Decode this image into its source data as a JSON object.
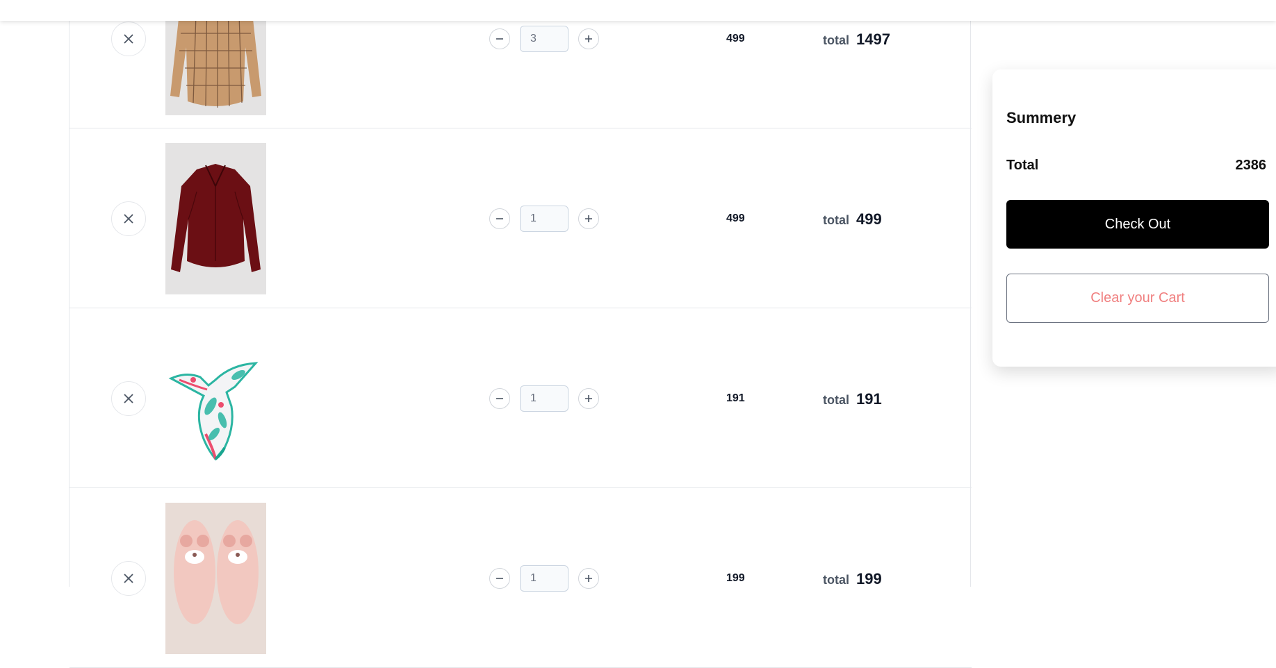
{
  "cart": {
    "items": [
      {
        "image": "plaid-shirt-image",
        "quantity": "3",
        "price": "499",
        "total_label": "total",
        "total": "1497"
      },
      {
        "image": "burgundy-blouse-image",
        "quantity": "1",
        "price": "499",
        "total_label": "total",
        "total": "499"
      },
      {
        "image": "printed-scarf-image",
        "quantity": "1",
        "price": "191",
        "total_label": "total",
        "total": "191"
      },
      {
        "image": "bear-slippers-image",
        "quantity": "1",
        "price": "199",
        "total_label": "total",
        "total": "199"
      }
    ]
  },
  "summary": {
    "title": "Summery",
    "total_label": "Total",
    "total_value": "2386",
    "checkout_label": "Check Out",
    "clear_label": "Clear your Cart"
  },
  "colors": {
    "checkout_bg": "#000000",
    "clear_text": "#f08080",
    "border": "#e5e7eb"
  },
  "icons": {
    "remove": "close-icon",
    "decrement": "minus-icon",
    "increment": "plus-icon"
  }
}
